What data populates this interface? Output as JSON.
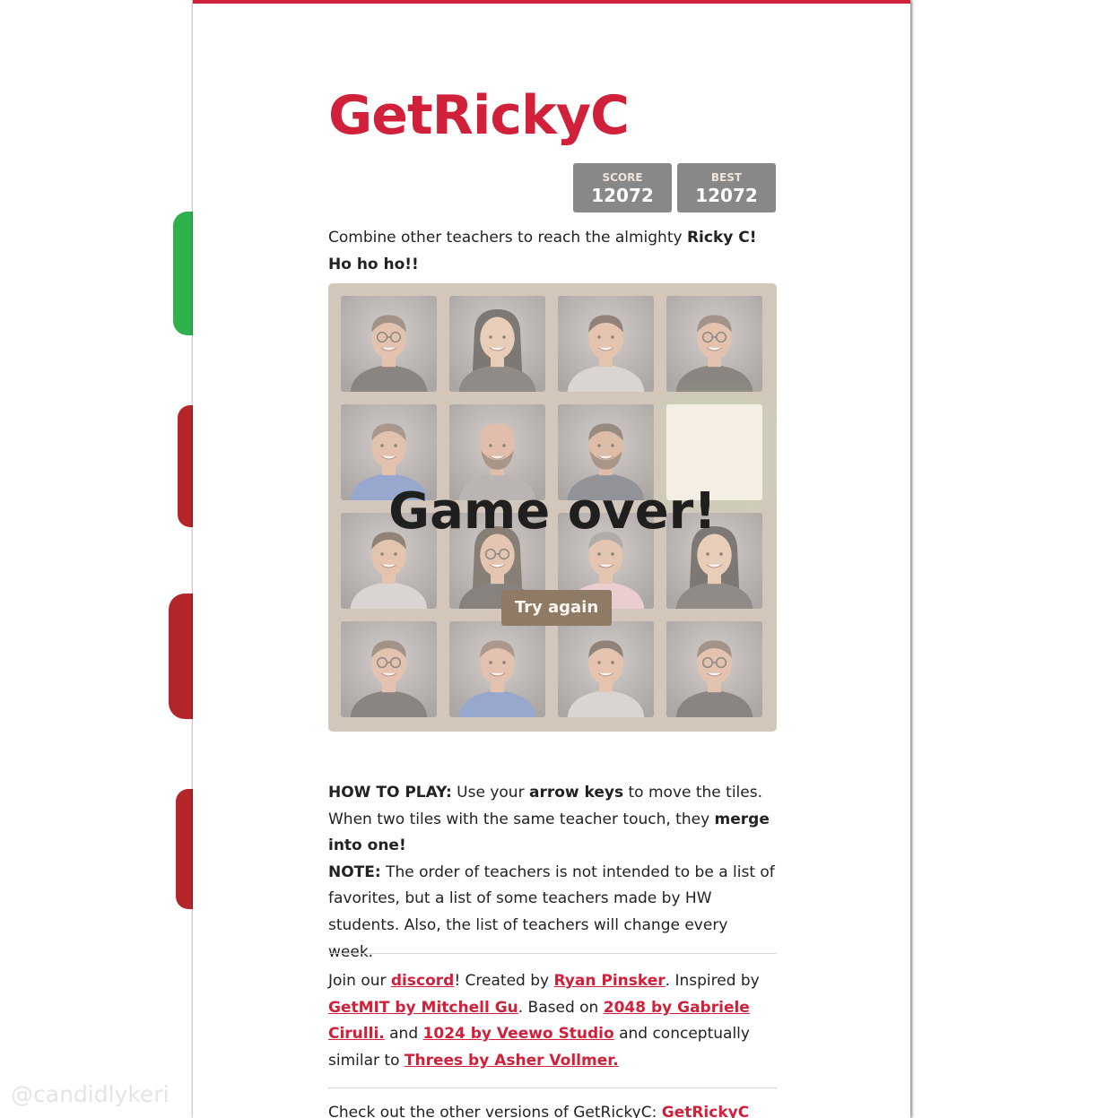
{
  "title": "GetRickyC",
  "score": {
    "label": "SCORE",
    "value": "12072"
  },
  "best": {
    "label": "BEST",
    "value": "12072"
  },
  "intro": {
    "text": "Combine other teachers to reach the almighty ",
    "bold": "Ricky C! Ho ho ho!!"
  },
  "board": {
    "tiles": [
      {
        "row": 0,
        "col": 0,
        "teacher": "teacher-glasses-man"
      },
      {
        "row": 0,
        "col": 1,
        "teacher": "teacher-woman-long-hair"
      },
      {
        "row": 0,
        "col": 2,
        "teacher": "teacher-smiling-man"
      },
      {
        "row": 0,
        "col": 3,
        "teacher": "teacher-glasses-man"
      },
      {
        "row": 1,
        "col": 0,
        "teacher": "teacher-man-blue-shirt"
      },
      {
        "row": 1,
        "col": 1,
        "teacher": "teacher-bald-bearded-man"
      },
      {
        "row": 1,
        "col": 2,
        "teacher": "teacher-bearded-man-cap"
      },
      {
        "row": 1,
        "col": 3,
        "teacher": "empty"
      },
      {
        "row": 2,
        "col": 0,
        "teacher": "teacher-smiling-man"
      },
      {
        "row": 2,
        "col": 1,
        "teacher": "teacher-woman-glasses"
      },
      {
        "row": 2,
        "col": 2,
        "teacher": "teacher-grey-hair-man"
      },
      {
        "row": 2,
        "col": 3,
        "teacher": "teacher-woman-long-hair"
      },
      {
        "row": 3,
        "col": 0,
        "teacher": "teacher-glasses-man"
      },
      {
        "row": 3,
        "col": 1,
        "teacher": "teacher-man-blue-shirt"
      },
      {
        "row": 3,
        "col": 2,
        "teacher": "teacher-smiling-man"
      },
      {
        "row": 3,
        "col": 3,
        "teacher": "teacher-glasses-man"
      }
    ],
    "game_over_text": "Game over!",
    "retry_label": "Try again"
  },
  "how_to_play": {
    "label": "HOW TO PLAY:",
    "t1": " Use your ",
    "b1": "arrow keys",
    "t2": " to move the tiles. When two tiles with the same teacher touch, they ",
    "b2": "merge into one!"
  },
  "note": {
    "label": "NOTE:",
    "text": " The order of teachers is not intended to be a list of favorites, but a list of some teachers made by HW students. Also, the list of teachers will change every week."
  },
  "credits": {
    "t1": "Join our ",
    "link_discord": "discord",
    "t2": "! Created by ",
    "link_author": "Ryan Pinsker",
    "t3": ". Inspired by ",
    "link_getmit": "GetMIT by Mitchell Gu",
    "t4": ". Based on ",
    "link_2048": "2048 by Gabriele Cirulli.",
    "t5": " and ",
    "link_1024": "1024 by Veewo Studio",
    "t6": " and conceptually similar to ",
    "link_threes": "Threes by Asher Vollmer."
  },
  "other_versions": {
    "text": "Check out the other versions of GetRickyC: ",
    "link": "GetRickyC MS"
  },
  "watermark": "@candidlykeri",
  "colors": {
    "brand_red": "#d0203a",
    "board": "#bbada0",
    "score_box": "#888888",
    "retry_button": "#8f7a66"
  }
}
